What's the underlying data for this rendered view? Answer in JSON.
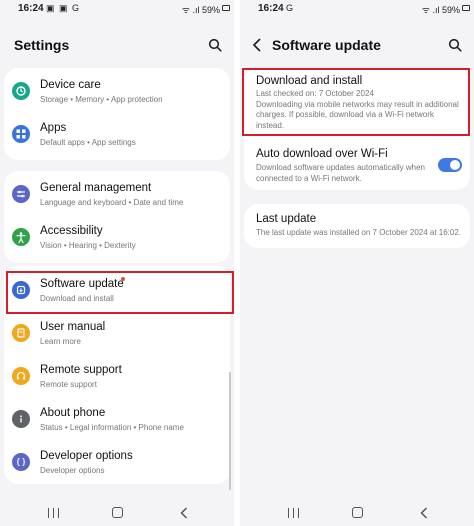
{
  "left_screen": {
    "status": {
      "time": "16:24",
      "notif_icons": "▣ ▣ G",
      "signal": "ᯤ .ıl",
      "battery": "59%"
    },
    "title": "Settings",
    "groups": [
      [
        {
          "id": "device-care",
          "label": "Device care",
          "subtitle": "Storage  •  Memory  •  App protection",
          "icon": "device-care-icon",
          "color": "#17a88c"
        },
        {
          "id": "apps",
          "label": "Apps",
          "subtitle": "Default apps  •  App settings",
          "icon": "apps-grid-icon",
          "color": "#3a73e0"
        }
      ],
      [
        {
          "id": "general-management",
          "label": "General management",
          "subtitle": "Language and keyboard  •  Date and time",
          "icon": "sliders-icon",
          "color": "#5b67c7"
        },
        {
          "id": "accessibility",
          "label": "Accessibility",
          "subtitle": "Vision  •  Hearing  •  Dexterity",
          "icon": "accessibility-icon",
          "color": "#2fa34a"
        }
      ],
      [
        {
          "id": "software-update",
          "label": "Software update",
          "subtitle": "Download and install",
          "icon": "software-update-icon",
          "color": "#3a67d6"
        },
        {
          "id": "user-manual",
          "label": "User manual",
          "subtitle": "Learn more",
          "icon": "user-manual-icon",
          "color": "#f0a91c"
        },
        {
          "id": "remote-support",
          "label": "Remote support",
          "subtitle": "Remote support",
          "icon": "headset-icon",
          "color": "#f0a91c"
        },
        {
          "id": "about-phone",
          "label": "About phone",
          "subtitle": "Status  •  Legal information  •  Phone name",
          "icon": "info-icon",
          "color": "#5f6368"
        },
        {
          "id": "developer-options",
          "label": "Developer options",
          "subtitle": "Developer options",
          "icon": "developer-braces-icon",
          "color": "#5b67c7"
        }
      ]
    ]
  },
  "right_screen": {
    "status": {
      "time": "16:24",
      "notif_icons": "G",
      "signal": "ᯤ .ıl",
      "battery": "59%"
    },
    "title": "Software update",
    "download": {
      "title": "Download and install",
      "lines": [
        "Last checked on: 7 October 2024",
        "Downloading via mobile networks may result in additional",
        "charges. If possible, download via a Wi-Fi network",
        "instead."
      ]
    },
    "auto_download": {
      "title": "Auto download over Wi-Fi",
      "lines": [
        "Download software updates automatically when",
        "connected to a Wi-Fi network."
      ],
      "enabled": true
    },
    "last_update": {
      "title": "Last update",
      "line": "The last update was installed on 7 October 2024 at 16:02."
    }
  },
  "colors": {
    "highlight": "#d21f2b",
    "toggle_on": "#3e79e4",
    "badge_dot": "#e04e3a"
  }
}
